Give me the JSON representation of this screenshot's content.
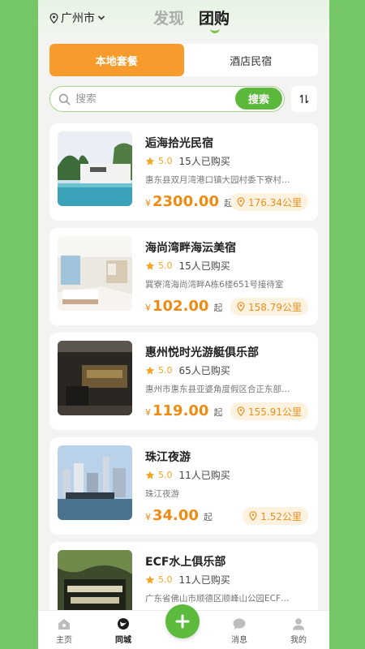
{
  "header": {
    "city": "广州市",
    "tabs": [
      {
        "label": "发现",
        "active": false
      },
      {
        "label": "团购",
        "active": true
      }
    ]
  },
  "segment": {
    "options": [
      {
        "label": "本地套餐",
        "active": true
      },
      {
        "label": "酒店民宿",
        "active": false
      }
    ]
  },
  "search": {
    "placeholder": "搜索",
    "button_label": "搜索",
    "sort_icon": "sort-arrows-icon"
  },
  "listings": [
    {
      "title": "逅海拾光民宿",
      "rating": "5.0",
      "buyers": "15人已购买",
      "address": "惠东县双月湾港口镇大园村委下寮村…",
      "currency": "¥",
      "price": "2300.00",
      "price_suffix": "起",
      "distance": "176.34公里"
    },
    {
      "title": "海尚湾畔海沄美宿",
      "rating": "5.0",
      "buyers": "15人已购买",
      "address": "巽寮湾海尚湾畔A栋6楼651号接待室",
      "currency": "¥",
      "price": "102.00",
      "price_suffix": "起",
      "distance": "158.79公里"
    },
    {
      "title": "惠州悦时光游艇俱乐部",
      "rating": "5.0",
      "buyers": "65人已购买",
      "address": "惠州市惠东县亚婆角度假区合正东部…",
      "currency": "¥",
      "price": "119.00",
      "price_suffix": "起",
      "distance": "155.91公里"
    },
    {
      "title": "珠江夜游",
      "rating": "5.0",
      "buyers": "11人已购买",
      "address": "珠江夜游",
      "currency": "¥",
      "price": "34.00",
      "price_suffix": "起",
      "distance": "1.52公里"
    },
    {
      "title": "ECF水上俱乐部",
      "rating": "5.0",
      "buyers": "11人已购买",
      "address": "广东省佛山市顺德区顺峰山公园ECF…",
      "currency": "¥",
      "price": "",
      "price_suffix": "",
      "distance": ""
    }
  ],
  "bottom_nav": {
    "items": [
      {
        "label": "主页",
        "icon": "home-icon",
        "active": false
      },
      {
        "label": "同城",
        "icon": "local-icon",
        "active": true
      },
      {
        "label": "",
        "icon": "plus-icon",
        "active": false
      },
      {
        "label": "消息",
        "icon": "message-icon",
        "active": false
      },
      {
        "label": "我的",
        "icon": "profile-icon",
        "active": false
      }
    ]
  },
  "colors": {
    "brand_green": "#5cb83c",
    "accent_orange": "#f79b2c",
    "price_orange": "#ee8b12",
    "side_background": "#74c666"
  }
}
